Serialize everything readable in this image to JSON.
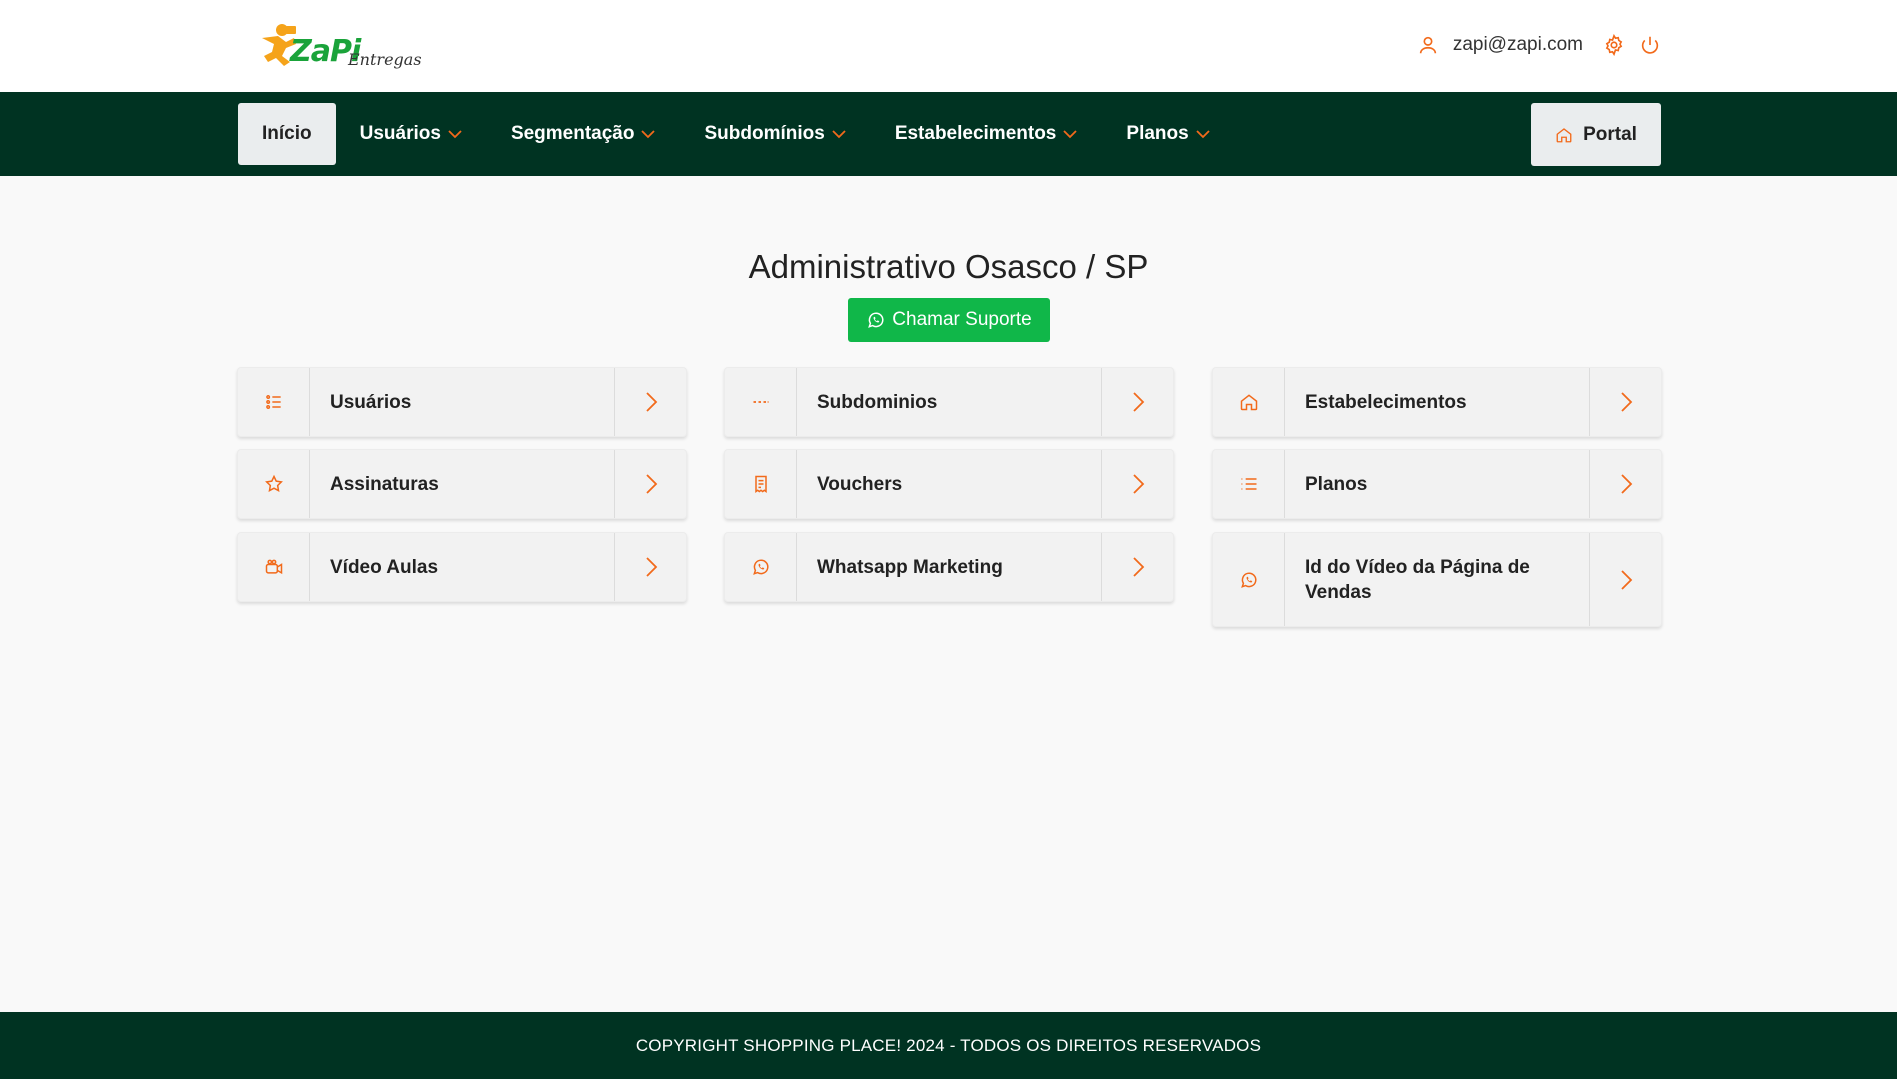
{
  "header": {
    "logo_text": "ZaPi",
    "logo_sub": "Entregas",
    "user_email": "zapi@zapi.com"
  },
  "nav": {
    "items": [
      {
        "label": "Início"
      },
      {
        "label": "Usuários"
      },
      {
        "label": "Segmentação"
      },
      {
        "label": "Subdomínios"
      },
      {
        "label": "Estabelecimentos"
      },
      {
        "label": "Planos"
      }
    ],
    "portal_label": "Portal"
  },
  "main": {
    "title": "Administrativo Osasco / SP",
    "support_label": "Chamar Suporte",
    "cards": [
      {
        "label": "Usuários",
        "icon": "list-icon"
      },
      {
        "label": "Subdominios",
        "icon": "dashes-icon"
      },
      {
        "label": "Estabelecimentos",
        "icon": "home-icon"
      },
      {
        "label": "Assinaturas",
        "icon": "star-icon"
      },
      {
        "label": "Vouchers",
        "icon": "receipt-icon"
      },
      {
        "label": "Planos",
        "icon": "list-lines-icon"
      },
      {
        "label": "Vídeo Aulas",
        "icon": "camera-icon"
      },
      {
        "label": "Whatsapp Marketing",
        "icon": "whatsapp-icon"
      },
      {
        "label": "Id do Vídeo da Página de Vendas",
        "icon": "whatsapp-icon"
      }
    ]
  },
  "footer": {
    "text": "COPYRIGHT SHOPPING PLACE! 2024 - TODOS OS DIREITOS RESERVADOS"
  },
  "colors": {
    "accent": "#f26a1b",
    "nav_bg": "#003322",
    "support_green": "#10b749",
    "logo_green": "#1aa33a",
    "logo_orange": "#f5a31a"
  }
}
